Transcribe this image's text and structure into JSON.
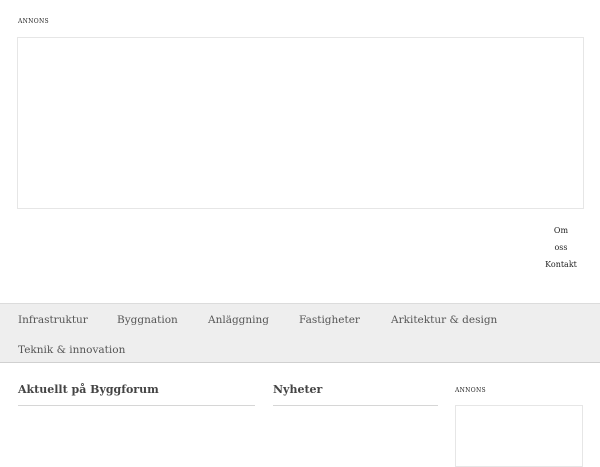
{
  "top_ad": {
    "label": "ANNONS"
  },
  "top_links": {
    "items": [
      "Om",
      "oss",
      "Kontakt"
    ]
  },
  "nav": {
    "items": [
      "Infrastruktur",
      "Byggnation",
      "Anläggning",
      "Fastigheter",
      "Arkitektur & design",
      "Teknik & innovation"
    ]
  },
  "sections": {
    "aktuellt_title": "Aktuellt på Byggforum",
    "nyheter_title": "Nyheter"
  },
  "side_ad": {
    "label": "ANNONS"
  }
}
